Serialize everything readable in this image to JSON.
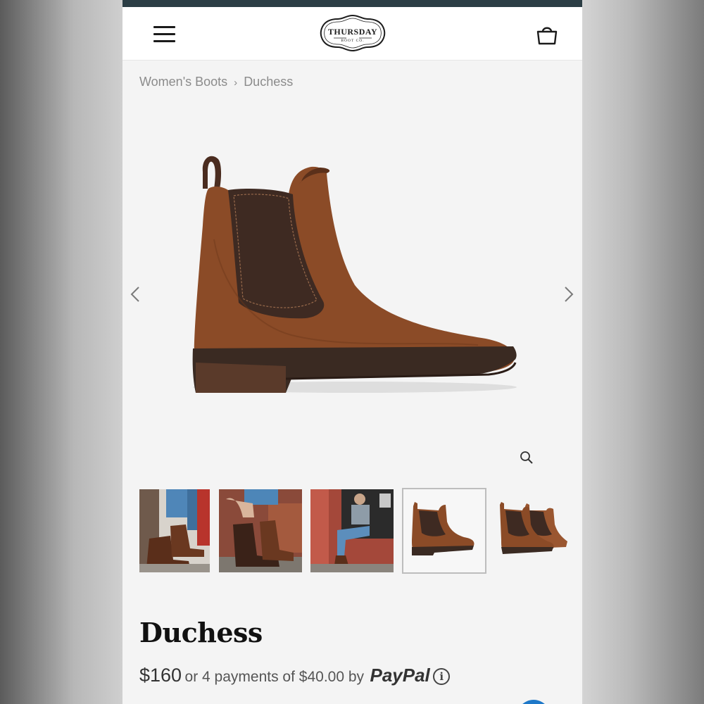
{
  "brand": {
    "name": "THURSDAY",
    "sub": "BOOT CO."
  },
  "breadcrumb": {
    "category": "Women's Boots",
    "separator": "›",
    "current": "Duchess"
  },
  "icons": {
    "menu": "hamburger-menu-icon",
    "cart": "shopping-bag-icon",
    "prev": "chevron-left-icon",
    "next": "chevron-right-icon",
    "zoom": "magnifier-icon",
    "info": "info-icon"
  },
  "gallery": {
    "thumbnails": [
      "lifestyle-photo-1",
      "lifestyle-photo-2",
      "lifestyle-photo-3",
      "side-view",
      "pair-view"
    ],
    "active_index": 3
  },
  "product": {
    "name": "Duchess",
    "price": "$160",
    "installment_text": "or 4 payments of $40.00 by",
    "paypal_label": "PayPal",
    "info_glyph": "i"
  },
  "colors": {
    "header_strip": "#2c3e45",
    "boot_suede": "#8a4a26",
    "elastic_gore": "#3e2a22",
    "sole": "#3a2a22"
  }
}
